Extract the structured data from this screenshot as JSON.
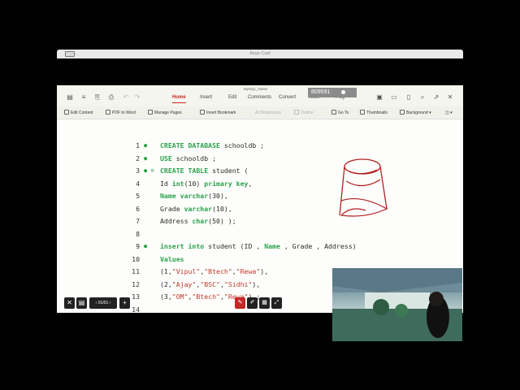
{
  "app": {
    "window_title": "Airgo Cast"
  },
  "document": {
    "name": "MySQL_Notes",
    "counter": "809591"
  },
  "menu": {
    "tabs": [
      "Home",
      "Insert",
      "Edit",
      "Comments",
      "Convert",
      "Tools",
      "Play"
    ],
    "active_tab": "Home"
  },
  "toolbar": {
    "edit_content": "Edit Content",
    "pdf_to_word": "PDF to Word",
    "manage_pages": "Manage Pages",
    "insert_bookmark": "Insert Bookmark",
    "all_bookmarks": "All Bookmarks",
    "outline": "Outline",
    "go_to": "Go To",
    "thumbnails": "Thumbnails",
    "background": "Background"
  },
  "code": {
    "lines": [
      {
        "n": "1",
        "marker": "●",
        "parts": [
          {
            "t": "CREATE DATABASE",
            "c": "kw"
          },
          {
            "t": " schooldb ;",
            "c": ""
          }
        ]
      },
      {
        "n": "2",
        "marker": "●",
        "parts": [
          {
            "t": "USE",
            "c": "kw"
          },
          {
            "t": " schooldb ;",
            "c": ""
          }
        ]
      },
      {
        "n": "3",
        "marker": "● ⊖",
        "parts": [
          {
            "t": "CREATE TABLE",
            "c": "kw"
          },
          {
            "t": " student (",
            "c": ""
          }
        ]
      },
      {
        "n": "4",
        "marker": "",
        "parts": [
          {
            "t": "Id ",
            "c": ""
          },
          {
            "t": "int",
            "c": "kw"
          },
          {
            "t": "(10) ",
            "c": ""
          },
          {
            "t": "primary key",
            "c": "kw"
          },
          {
            "t": ",",
            "c": ""
          }
        ]
      },
      {
        "n": "5",
        "marker": "",
        "parts": [
          {
            "t": "Name",
            "c": "kw"
          },
          {
            "t": " ",
            "c": ""
          },
          {
            "t": "varchar",
            "c": "kw"
          },
          {
            "t": "(30),",
            "c": ""
          }
        ]
      },
      {
        "n": "6",
        "marker": "",
        "parts": [
          {
            "t": "Grade ",
            "c": ""
          },
          {
            "t": "varchar",
            "c": "kw"
          },
          {
            "t": "(10),",
            "c": ""
          }
        ]
      },
      {
        "n": "7",
        "marker": "",
        "parts": [
          {
            "t": "Address ",
            "c": ""
          },
          {
            "t": "char",
            "c": "kw"
          },
          {
            "t": "(50) );",
            "c": ""
          }
        ]
      },
      {
        "n": "8",
        "marker": "",
        "parts": []
      },
      {
        "n": "9",
        "marker": "●",
        "parts": [
          {
            "t": "insert into",
            "c": "kw"
          },
          {
            "t": " student (ID , ",
            "c": ""
          },
          {
            "t": "Name",
            "c": "kw"
          },
          {
            "t": " , Grade , Address)",
            "c": ""
          }
        ]
      },
      {
        "n": "10",
        "marker": "",
        "parts": [
          {
            "t": "Values",
            "c": "kw"
          }
        ]
      },
      {
        "n": "11",
        "marker": "",
        "parts": [
          {
            "t": "(1,",
            "c": ""
          },
          {
            "t": "\"Vipul\"",
            "c": "str"
          },
          {
            "t": ",",
            "c": ""
          },
          {
            "t": "\"Btech\"",
            "c": "str"
          },
          {
            "t": ",",
            "c": ""
          },
          {
            "t": "\"Rewa\"",
            "c": "str"
          },
          {
            "t": "),",
            "c": ""
          }
        ]
      },
      {
        "n": "12",
        "marker": "",
        "parts": [
          {
            "t": "(2,",
            "c": ""
          },
          {
            "t": "\"Ajay\"",
            "c": "str"
          },
          {
            "t": ",",
            "c": ""
          },
          {
            "t": "\"BSC\"",
            "c": "str"
          },
          {
            "t": ",",
            "c": ""
          },
          {
            "t": "\"Sidhi\"",
            "c": "str"
          },
          {
            "t": "),",
            "c": ""
          }
        ]
      },
      {
        "n": "13",
        "marker": "",
        "parts": [
          {
            "t": "(3,",
            "c": ""
          },
          {
            "t": "\"OM\"",
            "c": "str"
          },
          {
            "t": ",",
            "c": ""
          },
          {
            "t": "\"Btech\"",
            "c": "str"
          },
          {
            "t": ",",
            "c": ""
          },
          {
            "t": "\"Rewa\"",
            "c": "str"
          },
          {
            "t": ") ;",
            "c": ""
          }
        ]
      },
      {
        "n": "14",
        "marker": "",
        "parts": []
      }
    ]
  },
  "page_nav": {
    "label": "01/01"
  },
  "colors": {
    "keyword": "#2ba24c",
    "string": "#c03a2b",
    "accent": "#c6271c",
    "annotation": "#c62828"
  }
}
